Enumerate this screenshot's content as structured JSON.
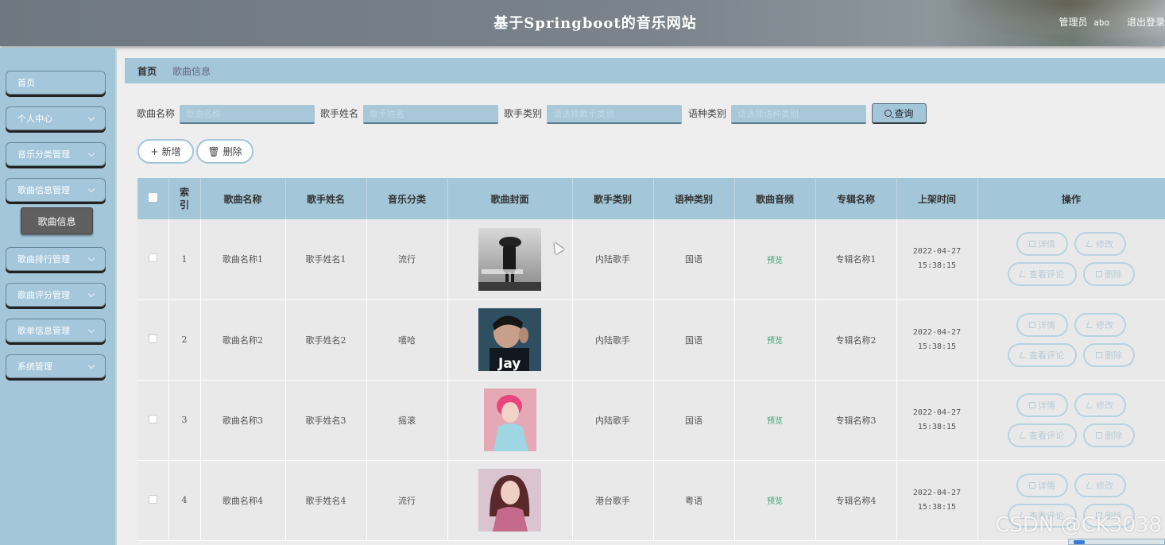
{
  "header": {
    "title": "基于Springboot的音乐网站",
    "role": "管理员",
    "username": "abo",
    "logout": "退出登录"
  },
  "sidebar": {
    "items": [
      {
        "label": "首页",
        "has_arrow": false
      },
      {
        "label": "个人中心",
        "has_arrow": true
      },
      {
        "label": "音乐分类管理",
        "has_arrow": true
      },
      {
        "label": "歌曲信息管理",
        "has_arrow": true
      },
      {
        "label": "歌曲排行管理",
        "has_arrow": true
      },
      {
        "label": "歌曲评分管理",
        "has_arrow": true
      },
      {
        "label": "歌单信息管理",
        "has_arrow": true
      },
      {
        "label": "系统管理",
        "has_arrow": true
      }
    ],
    "submenu": "歌曲信息"
  },
  "breadcrumb": {
    "home": "首页",
    "current": "歌曲信息"
  },
  "search": {
    "fields": [
      {
        "label": "歌曲名称",
        "placeholder": "歌曲名称"
      },
      {
        "label": "歌手姓名",
        "placeholder": "歌手姓名"
      },
      {
        "label": "歌手类别",
        "placeholder": "请选择歌手类别"
      },
      {
        "label": "语种类别",
        "placeholder": "请选择语种类别"
      }
    ],
    "button": "查询"
  },
  "actions": {
    "add": "新增",
    "delete": "删除"
  },
  "table": {
    "headers": [
      "",
      "索引",
      "歌曲名称",
      "歌手姓名",
      "音乐分类",
      "歌曲封面",
      "歌手类别",
      "语种类别",
      "歌曲音频",
      "专辑名称",
      "上架时间",
      "操作"
    ],
    "rows": [
      {
        "index": "1",
        "name": "歌曲名称1",
        "singer": "歌手姓名1",
        "category": "流行",
        "singer_type": "内陆歌手",
        "language": "国语",
        "audio": "预览",
        "album": "专辑名称1",
        "time": "2022-04-27 15:38:15"
      },
      {
        "index": "2",
        "name": "歌曲名称2",
        "singer": "歌手姓名2",
        "category": "嘻哈",
        "singer_type": "内陆歌手",
        "language": "国语",
        "audio": "预览",
        "album": "专辑名称2",
        "time": "2022-04-27 15:38:15"
      },
      {
        "index": "3",
        "name": "歌曲名称3",
        "singer": "歌手姓名3",
        "category": "摇滚",
        "singer_type": "内陆歌手",
        "language": "国语",
        "audio": "预览",
        "album": "专辑名称3",
        "time": "2022-04-27 15:38:15"
      },
      {
        "index": "4",
        "name": "歌曲名称4",
        "singer": "歌手姓名4",
        "category": "流行",
        "singer_type": "港台歌手",
        "language": "粤语",
        "audio": "预览",
        "album": "专辑名称4",
        "time": "2022-04-27 15:38:15"
      }
    ],
    "row_actions": {
      "detail": "详情",
      "edit": "修改",
      "comments": "查看评论",
      "delete": "删除"
    },
    "cover2_text": "Jay"
  },
  "watermark": "CSDN @CK3038",
  "colors": {
    "theme": "#a3c6d9",
    "header": "#7a838c",
    "active_submenu": "#5f5f5f",
    "preview_link": "#3aa37a"
  }
}
